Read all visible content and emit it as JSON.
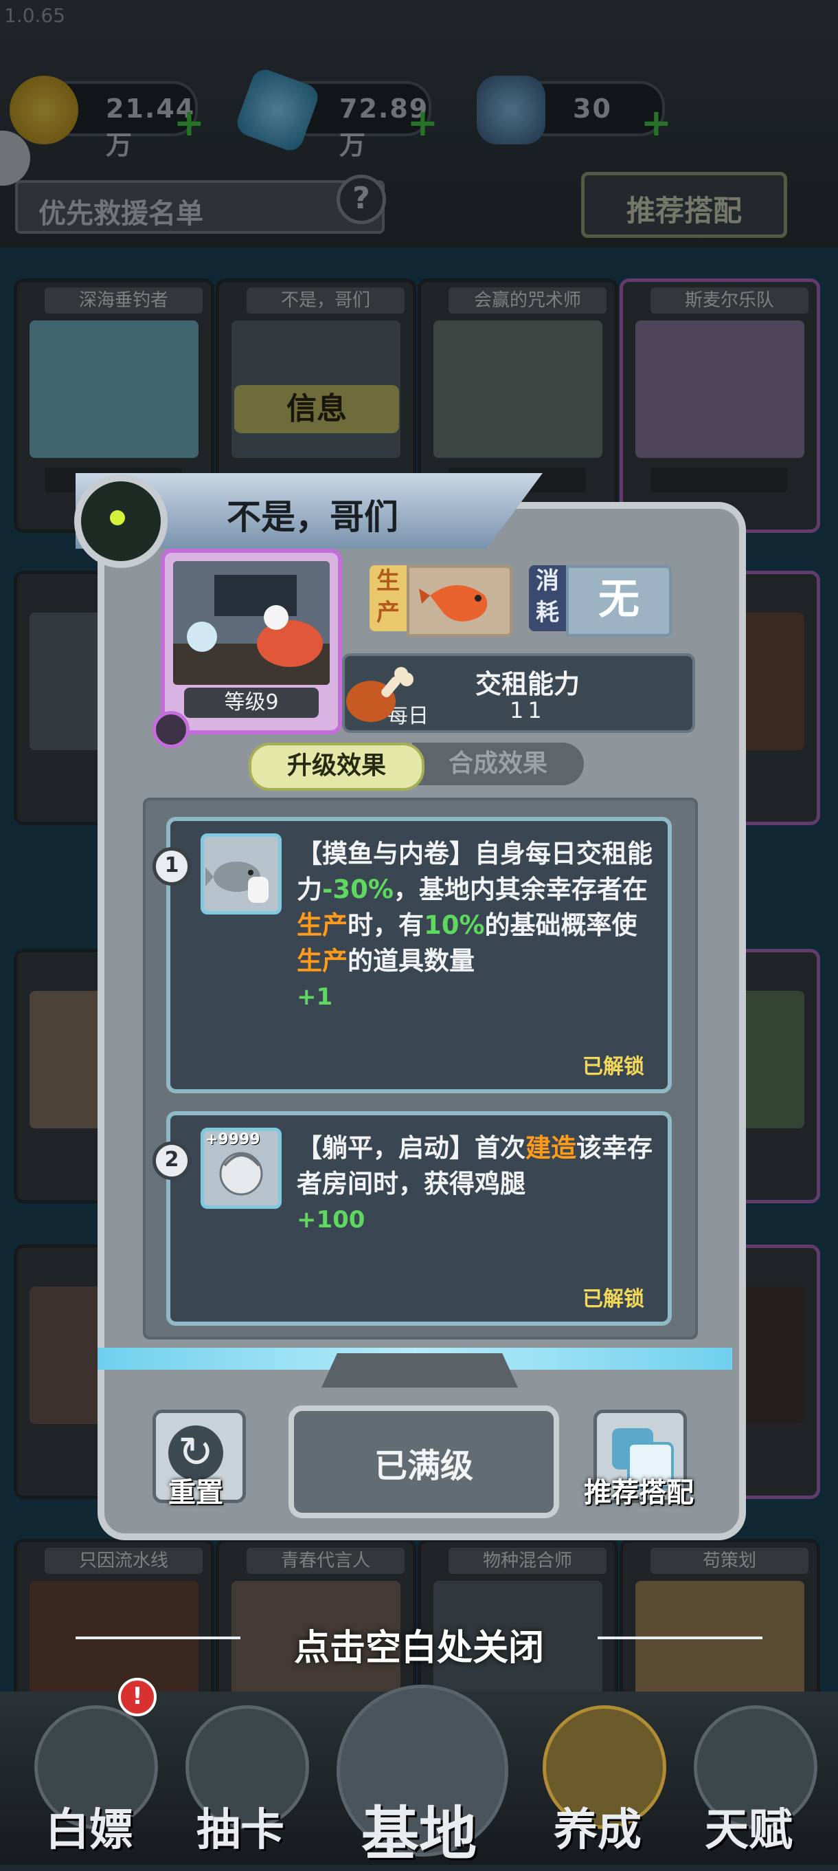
{
  "version": "1.0.65",
  "resources": [
    {
      "icon": "gold-coin-icon",
      "value": "21.44万"
    },
    {
      "icon": "blue-crystal-icon",
      "value": "72.89万"
    },
    {
      "icon": "energy-battery-icon",
      "value": "30"
    }
  ],
  "priority_list_label": "优先救援名单",
  "help_label": "?",
  "recommend_button": "推荐搭配",
  "bg_cards": [
    "深海垂钓者",
    "不是，哥们",
    "会赢的咒术师",
    "斯麦尔乐队",
    "只因流水线",
    "青春代言人",
    "物种混合师",
    "苟策划"
  ],
  "bg_overlay": {
    "info": "信息",
    "level_text": "等级9",
    "maxed": "已满级"
  },
  "modal": {
    "title": "不是，哥们",
    "level": "等级9",
    "produce_tag": "生产",
    "consume_tag": "消耗",
    "consume_value": "无",
    "rent_title": "交租能力",
    "rent_period": "每日",
    "rent_value": "11",
    "tab_upgrade": "升级效果",
    "tab_merge": "合成效果",
    "effects": [
      {
        "num": "1",
        "p1": "【摸鱼与内卷】自身每日交租能力",
        "v1": "-30%",
        "p2": "，基地内其余幸存者在",
        "k1": "生产",
        "p3": "时，有",
        "v2": "10%",
        "p4": "的基础概率使",
        "k2": "生产",
        "p5": "的道具数量",
        "bonus": "+1",
        "status": "已解锁"
      },
      {
        "num": "2",
        "icon_badge": "+9999",
        "p1": "【躺平，启动】首次",
        "k1": "建造",
        "p2": "该幸存者房间时，获得鸡腿",
        "bonus": "+100",
        "status": "已解锁"
      }
    ],
    "reset_label": "重置",
    "max_label": "已满级",
    "recommend_label": "推荐搭配"
  },
  "close_hint": "点击空白处关闭",
  "nav": [
    {
      "label": "白嫖",
      "icon": "cart-icon"
    },
    {
      "label": "抽卡",
      "icon": "ssr-icon"
    },
    {
      "label": "基地",
      "icon": "base-icon"
    },
    {
      "label": "养成",
      "icon": "exp-icon"
    },
    {
      "label": "天赋",
      "icon": "dna-icon"
    }
  ],
  "nav_alert": "!",
  "colors": {
    "accent_green": "#5ed85f",
    "accent_orange": "#ff9b1a",
    "unlock_yellow": "#f3d85a"
  }
}
